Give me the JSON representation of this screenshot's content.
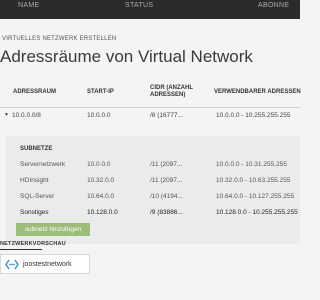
{
  "background_header": {
    "columns": [
      "NAME",
      "STATUS",
      "ABONNE"
    ]
  },
  "dialog": {
    "eyebrow": "VIRTUELLES NETZWERK ERSTELLEN",
    "title": "Adressräume von Virtual Network"
  },
  "table": {
    "headers": {
      "address_space": "ADRESSRAUM",
      "start_ip": "START-IP",
      "cidr": "CIDR (ANZAHL ADRESSEN)",
      "usable": "VERWENDBARER ADRESSEN"
    },
    "address_row": {
      "address_space": "10.0.0.0/8",
      "start_ip": "10.0.0.0",
      "cidr": "/8 (16777...",
      "usable": "10.0.0.0 - 10.255.255.255"
    }
  },
  "subnets": {
    "title": "SUBNETZE",
    "rows": [
      {
        "name": "Servernetzwerk",
        "start_ip": "10.0.0.0",
        "cidr": "/11 (2097...",
        "usable": "10.0.0.0 - 10.31.255.255",
        "bold": false
      },
      {
        "name": "HDInsight",
        "start_ip": "10.32.0.0",
        "cidr": "/11 (2097...",
        "usable": "10.32.0.0 - 10.63.255.255",
        "bold": false
      },
      {
        "name": "SQL-Server",
        "start_ip": "10.64.0.0",
        "cidr": "/10 (4194...",
        "usable": "10.64.0.0 - 10.127.255.255",
        "bold": false
      },
      {
        "name": "Sonstiges",
        "start_ip": "10.128.0.0",
        "cidr": "/9 (83886...",
        "usable": "10.128.0.0 - 10.255.255.255",
        "bold": true
      }
    ],
    "add_button": "subnetz hinzufügen"
  },
  "preview": {
    "label": "NETZWERKVORSCHAU",
    "network_name": "joostestnetwork",
    "icon": "network-icon"
  },
  "colors": {
    "accent_green": "#9cbd7a",
    "icon_blue": "#3a8fd6",
    "header_dark": "#2b2b2b"
  }
}
